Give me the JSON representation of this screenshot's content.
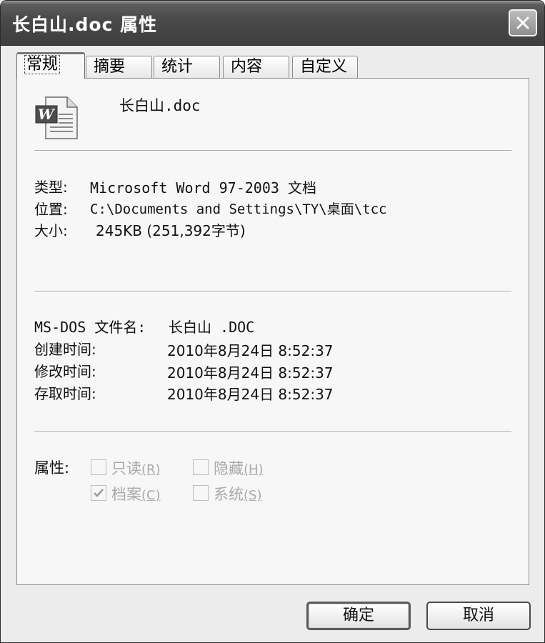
{
  "window": {
    "title": "长白山.doc 属性",
    "close_symbol": "✕"
  },
  "tabs": [
    {
      "label": "常规",
      "active": true
    },
    {
      "label": "摘要",
      "active": false
    },
    {
      "label": "统计",
      "active": false
    },
    {
      "label": "内容",
      "active": false
    },
    {
      "label": "自定义",
      "active": false
    }
  ],
  "general": {
    "file_icon": "word-document-icon",
    "file_name": "长白山.doc",
    "type_label": "类型:",
    "type_value": "Microsoft Word 97-2003 文档",
    "location_label": "位置:",
    "location_value": "C:\\Documents and Settings\\TY\\桌面\\tcc",
    "size_label": "大小:",
    "size_value": "245KB (251,392字节)",
    "msdos_label": "MS-DOS 文件名:",
    "msdos_value": "长白山 .DOC",
    "created_label": "创建时间:",
    "created_value": "2010年8月24日 8:52:37",
    "modified_label": "修改时间:",
    "modified_value": "2010年8月24日 8:52:37",
    "accessed_label": "存取时间:",
    "accessed_value": "2010年8月24日 8:52:37"
  },
  "attributes": {
    "label": "属性:",
    "readonly": {
      "text": "只读",
      "key": "(R)",
      "checked": false
    },
    "hidden": {
      "text": "隐藏",
      "key": "(H)",
      "checked": false
    },
    "archive": {
      "text": "档案",
      "key": "(C)",
      "checked": true
    },
    "system": {
      "text": "系统",
      "key": "(S)",
      "checked": false
    }
  },
  "buttons": {
    "ok": "确定",
    "cancel": "取消"
  }
}
